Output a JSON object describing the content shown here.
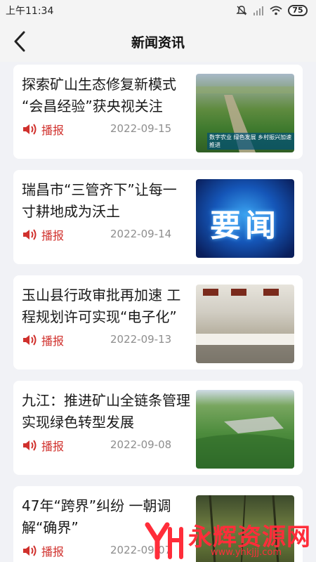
{
  "status": {
    "time": "上午11:34",
    "battery": "75"
  },
  "header": {
    "title": "新闻资讯"
  },
  "news": [
    {
      "title": "探索矿山生态修复新模式 “会昌经验”获央视关注",
      "play_label": "播报",
      "date": "2022-09-15",
      "thumb_caption": "数字农业 绿色发展 乡村振兴加速推进"
    },
    {
      "title": "瑞昌市“三管齐下”让每一寸耕地成为沃土",
      "play_label": "播报",
      "date": "2022-09-14",
      "thumb_text": "要闻"
    },
    {
      "title": "玉山县行政审批再加速 工程规划许可实现“电子化”",
      "play_label": "播报",
      "date": "2022-09-13"
    },
    {
      "title": "九江：推进矿山全链条管理 实现绿色转型发展",
      "play_label": "播报",
      "date": "2022-09-08"
    },
    {
      "title": "47年“跨界”纠纷 一朝调解“确界”",
      "play_label": "播报",
      "date": "2022-09-07"
    }
  ],
  "watermark": {
    "text": "永辉资源网",
    "url": "www.yhkjjj.com"
  },
  "colors": {
    "accent": "#d0312d",
    "background": "#f1f2f6",
    "card": "#ffffff",
    "date": "#8e8e8e"
  }
}
